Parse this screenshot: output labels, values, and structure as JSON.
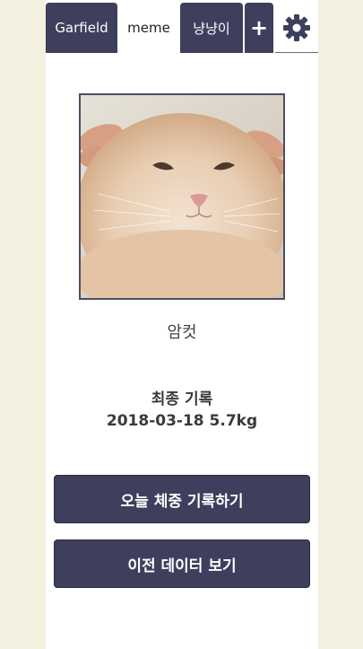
{
  "tabs": [
    {
      "label": "Garfield",
      "active": false
    },
    {
      "label": "meme",
      "active": true
    },
    {
      "label": "냥냥이",
      "active": false
    }
  ],
  "add_tab_label": "+",
  "settings_icon": "gear-icon",
  "cat": {
    "name": "암컷",
    "photo": "cat-photo"
  },
  "record": {
    "label": "최종 기록",
    "value": "2018-03-18 5.7kg"
  },
  "buttons": {
    "record_today": "오늘 체중 기록하기",
    "view_history": "이전 데이터 보기"
  },
  "colors": {
    "accent": "#3d3f5c",
    "background": "#f3f0e0"
  }
}
